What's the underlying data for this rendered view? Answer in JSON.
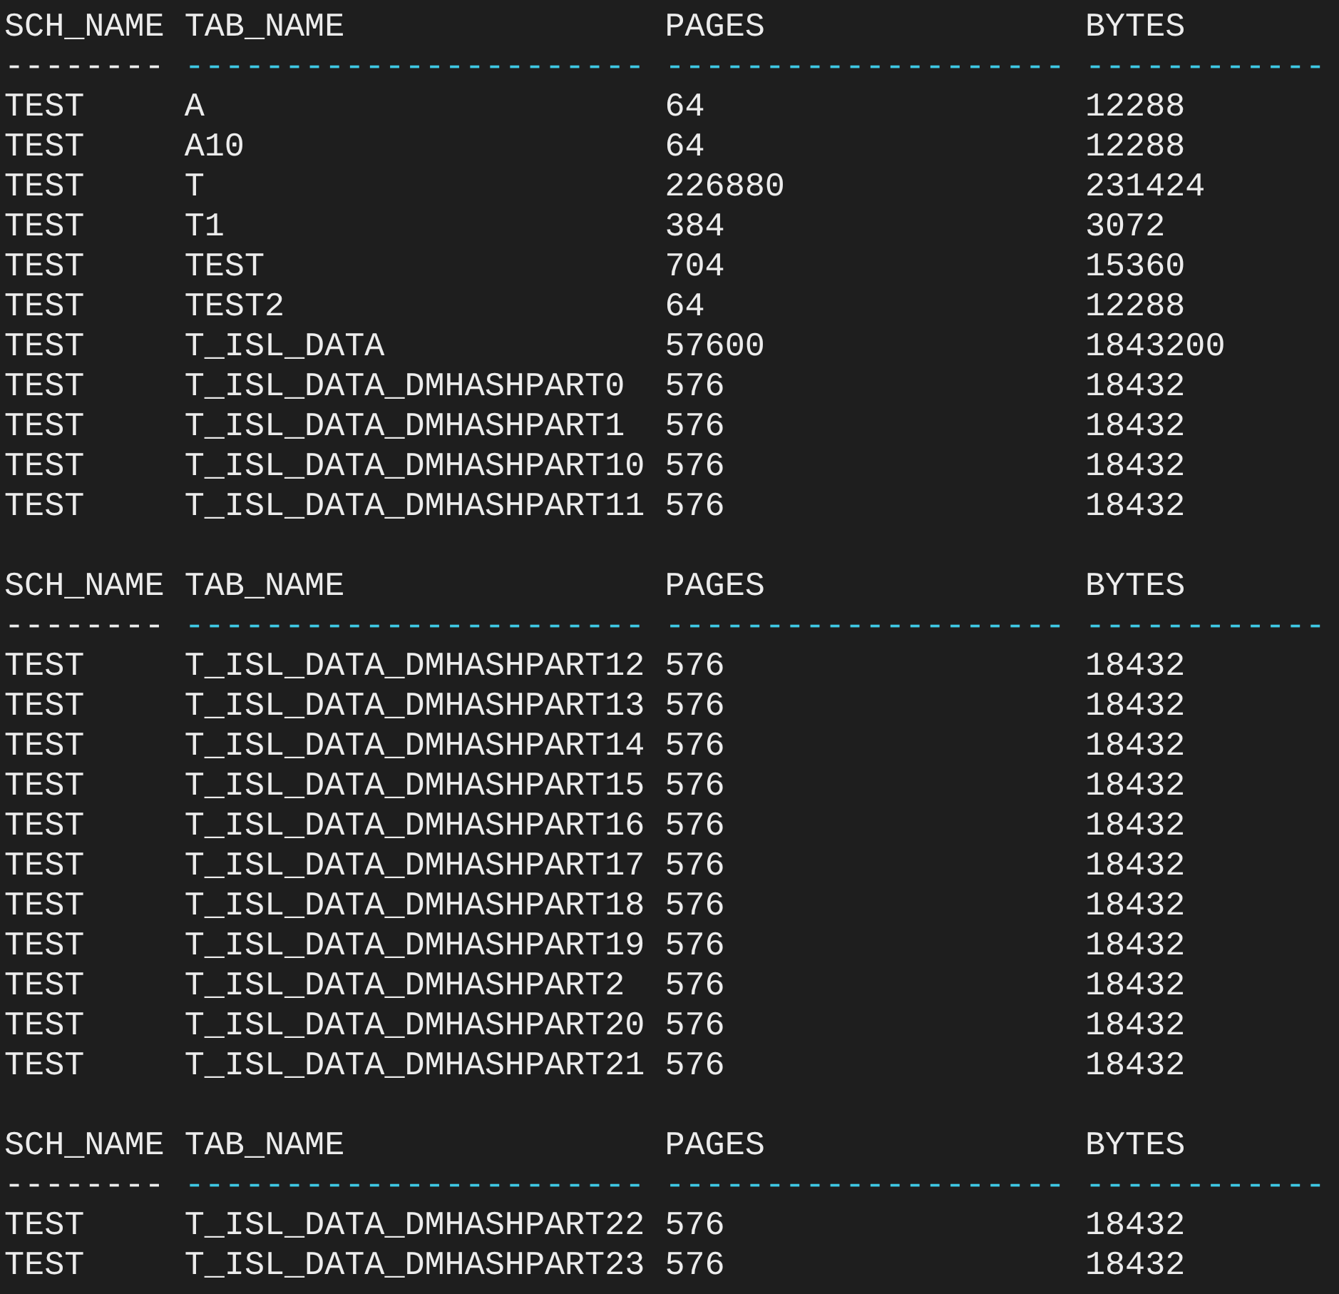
{
  "blocks": [
    {
      "header": [
        "SCH_NAME",
        "TAB_NAME",
        "PAGES",
        "BYTES"
      ],
      "separator": [
        "--------",
        "-----------------------",
        "--------------------",
        "------------"
      ],
      "rows": [
        [
          "TEST",
          "A",
          "64",
          "12288"
        ],
        [
          "TEST",
          "A10",
          "64",
          "12288"
        ],
        [
          "TEST",
          "T",
          "226880",
          "231424"
        ],
        [
          "TEST",
          "T1",
          "384",
          "3072"
        ],
        [
          "TEST",
          "TEST",
          "704",
          "15360"
        ],
        [
          "TEST",
          "TEST2",
          "64",
          "12288"
        ],
        [
          "TEST",
          "T_ISL_DATA",
          "57600",
          "1843200"
        ],
        [
          "TEST",
          "T_ISL_DATA_DMHASHPART0",
          "576",
          "18432"
        ],
        [
          "TEST",
          "T_ISL_DATA_DMHASHPART1",
          "576",
          "18432"
        ],
        [
          "TEST",
          "T_ISL_DATA_DMHASHPART10",
          "576",
          "18432"
        ],
        [
          "TEST",
          "T_ISL_DATA_DMHASHPART11",
          "576",
          "18432"
        ]
      ]
    },
    {
      "header": [
        "SCH_NAME",
        "TAB_NAME",
        "PAGES",
        "BYTES"
      ],
      "separator": [
        "--------",
        "-----------------------",
        "--------------------",
        "------------"
      ],
      "rows": [
        [
          "TEST",
          "T_ISL_DATA_DMHASHPART12",
          "576",
          "18432"
        ],
        [
          "TEST",
          "T_ISL_DATA_DMHASHPART13",
          "576",
          "18432"
        ],
        [
          "TEST",
          "T_ISL_DATA_DMHASHPART14",
          "576",
          "18432"
        ],
        [
          "TEST",
          "T_ISL_DATA_DMHASHPART15",
          "576",
          "18432"
        ],
        [
          "TEST",
          "T_ISL_DATA_DMHASHPART16",
          "576",
          "18432"
        ],
        [
          "TEST",
          "T_ISL_DATA_DMHASHPART17",
          "576",
          "18432"
        ],
        [
          "TEST",
          "T_ISL_DATA_DMHASHPART18",
          "576",
          "18432"
        ],
        [
          "TEST",
          "T_ISL_DATA_DMHASHPART19",
          "576",
          "18432"
        ],
        [
          "TEST",
          "T_ISL_DATA_DMHASHPART2",
          "576",
          "18432"
        ],
        [
          "TEST",
          "T_ISL_DATA_DMHASHPART20",
          "576",
          "18432"
        ],
        [
          "TEST",
          "T_ISL_DATA_DMHASHPART21",
          "576",
          "18432"
        ]
      ]
    },
    {
      "header": [
        "SCH_NAME",
        "TAB_NAME",
        "PAGES",
        "BYTES"
      ],
      "separator": [
        "--------",
        "-----------------------",
        "--------------------",
        "------------"
      ],
      "rows": [
        [
          "TEST",
          "T_ISL_DATA_DMHASHPART22",
          "576",
          "18432"
        ],
        [
          "TEST",
          "T_ISL_DATA_DMHASHPART23",
          "576",
          "18432"
        ]
      ]
    }
  ]
}
